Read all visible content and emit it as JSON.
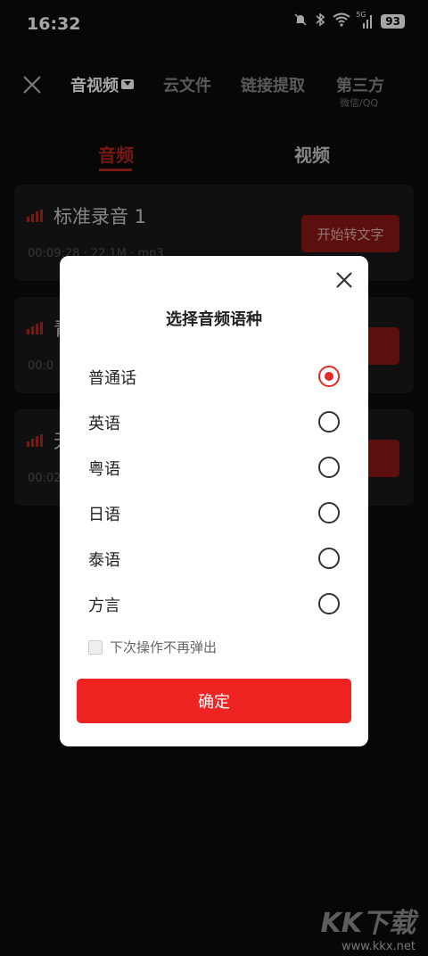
{
  "status": {
    "time": "16:32",
    "battery": "93",
    "network": "5G"
  },
  "topnav": {
    "tabs": [
      "音视频",
      "云文件",
      "链接提取",
      "第三方"
    ],
    "third_party_sub": "微信/QQ"
  },
  "subtabs": [
    "音频",
    "视频"
  ],
  "cards": [
    {
      "title": "标准录音 1",
      "meta": "00:09:28 · 22.1M · mp3",
      "button": "开始转文字"
    },
    {
      "title": "青",
      "meta": "00:0",
      "button": "文字"
    },
    {
      "title": "无",
      "meta": "00:02",
      "button": "文字"
    }
  ],
  "dialog": {
    "title": "选择音频语种",
    "options": [
      "普通话",
      "英语",
      "粤语",
      "日语",
      "泰语",
      "方言"
    ],
    "selected_index": 0,
    "dont_show_label": "下次操作不再弹出",
    "dont_show_checked": false,
    "confirm_label": "确定"
  },
  "watermark": {
    "logo": "KK下载",
    "url": "www.kkx.net"
  },
  "colors": {
    "accent": "#f02323",
    "dark_accent": "#8e1a16",
    "background": "#0b0b0b"
  }
}
